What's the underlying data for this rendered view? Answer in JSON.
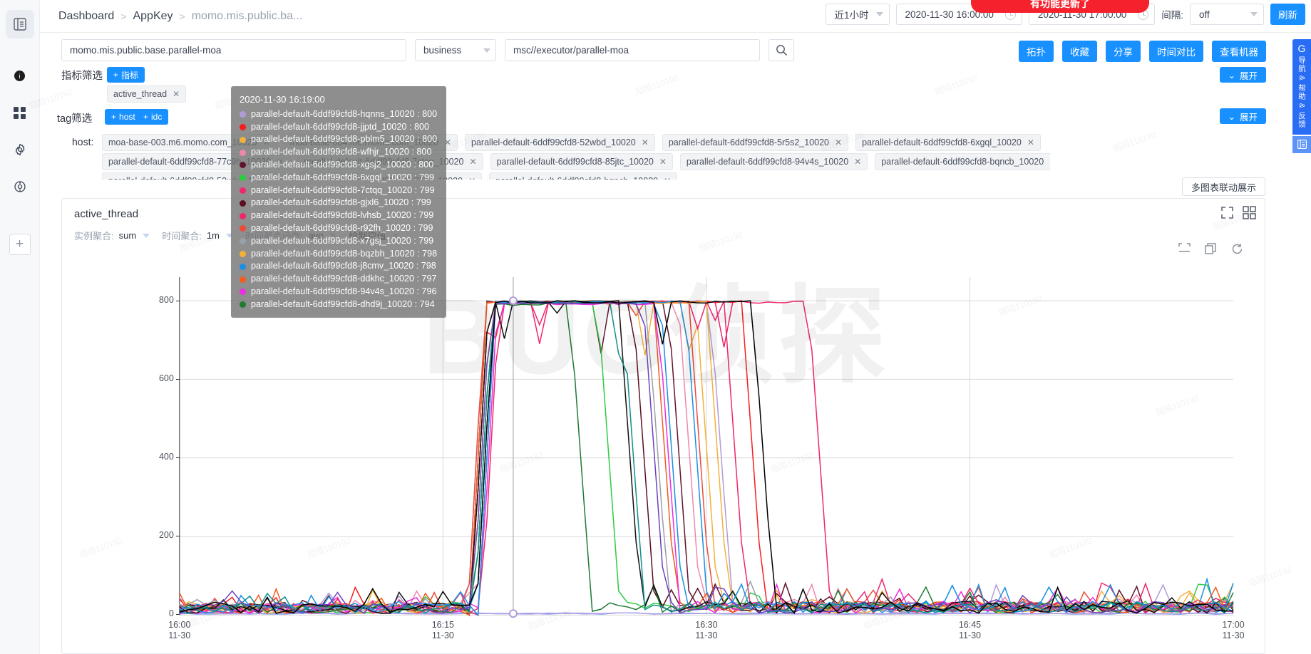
{
  "breadcrumb": {
    "items": [
      "Dashboard",
      "AppKey",
      "momo.mis.public.ba..."
    ],
    "sep": ">"
  },
  "topbar": {
    "range_preset": "近1小时",
    "start_time": "2020-11-30 16:00:00",
    "end_time": "2020-11-30 17:00:00",
    "interval_label": "间隔:",
    "interval_value": "off",
    "refresh_label": "刷新",
    "update_banner": "有功能更新了"
  },
  "query": {
    "appkey_value": "momo.mis.public.base.parallel-moa",
    "type_value": "business",
    "path_value": "msc//executor/parallel-moa",
    "search_icon": "search-icon"
  },
  "actions": [
    {
      "label": "拓扑",
      "name": "topology-button"
    },
    {
      "label": "收藏",
      "name": "favorite-button"
    },
    {
      "label": "分享",
      "name": "share-button"
    },
    {
      "label": "时间对比",
      "name": "time-compare-button"
    },
    {
      "label": "查看机器",
      "name": "view-machine-button"
    }
  ],
  "filters": {
    "metric_label": "指标筛选",
    "metric_add_button": "指标",
    "metric_chips": [
      "active_thread"
    ],
    "tag_label": "tag筛选",
    "tag_add_buttons": [
      "host",
      "idc"
    ],
    "host_label": "host:",
    "expand_label": "展开"
  },
  "host_chips": [
    [
      "moa-base-003.m6.momo.com_10020",
      "moa-base-004.m6.momo.com_10020",
      "parallel-default-6ddf99cfd8-52wbd_10020",
      "parallel-default-6ddf99cfd8-5r5s2_10020",
      "parallel-default-6ddf99cfd8-6xgql_10020"
    ],
    [
      "parallel-default-6ddf99cfd8-77c9h_10020",
      "parallel-default-6ddf99cfd8-7ctqq_10020",
      "parallel-default-6ddf99cfd8-85jtc_10020",
      "parallel-default-6ddf99cfd8-94v4s_10020",
      "parallel-default-6ddf99cfd8-bqncb_10020"
    ]
  ],
  "multi_chart_button": "多图表联动展示",
  "chart_panel": {
    "title": "active_thread",
    "agg": [
      {
        "label": "实例聚合:",
        "value": "sum"
      },
      {
        "label": "时间聚合:",
        "value": "1m"
      },
      {
        "label": "时间聚合函数:",
        "value": "avg"
      }
    ],
    "draw_null_label": "绘制空值",
    "tools": [
      "fullscreen-icon",
      "grid-icon"
    ],
    "tools2": [
      "zoom-out-icon",
      "copy-icon",
      "refresh-icon"
    ]
  },
  "tooltip": {
    "time": "2020-11-30 16:19:00",
    "rows": [
      {
        "name": "parallel-default-6ddf99cfd8-hqnns_10020",
        "value": 800,
        "color": "#b19cd9"
      },
      {
        "name": "parallel-default-6ddf99cfd8-jjptd_10020",
        "value": 800,
        "color": "#f81d1d"
      },
      {
        "name": "parallel-default-6ddf99cfd8-pblm5_10020",
        "value": 800,
        "color": "#f2b13b"
      },
      {
        "name": "parallel-default-6ddf99cfd8-wfhjr_10020",
        "value": 800,
        "color": "#ef87ae"
      },
      {
        "name": "parallel-default-6ddf99cfd8-xgsj2_10020",
        "value": 800,
        "color": "#62142e"
      },
      {
        "name": "parallel-default-6ddf99cfd8-6xgql_10020",
        "value": 799,
        "color": "#2ecc40"
      },
      {
        "name": "parallel-default-6ddf99cfd8-7ctqq_10020",
        "value": 799,
        "color": "#f0256f"
      },
      {
        "name": "parallel-default-6ddf99cfd8-gjxl6_10020",
        "value": 799,
        "color": "#5c0f22"
      },
      {
        "name": "parallel-default-6ddf99cfd8-lvhsb_10020",
        "value": 799,
        "color": "#f0256f"
      },
      {
        "name": "parallel-default-6ddf99cfd8-r92fh_10020",
        "value": 799,
        "color": "#ec4b3a"
      },
      {
        "name": "parallel-default-6ddf99cfd8-x7gsj_10020",
        "value": 799,
        "color": "#9aa0a8"
      },
      {
        "name": "parallel-default-6ddf99cfd8-bqzbh_10020",
        "value": 798,
        "color": "#f2b13b"
      },
      {
        "name": "parallel-default-6ddf99cfd8-j8cmv_10020",
        "value": 798,
        "color": "#1a8fe3"
      },
      {
        "name": "parallel-default-6ddf99cfd8-ddkhc_10020",
        "value": 797,
        "color": "#f25c1e"
      },
      {
        "name": "parallel-default-6ddf99cfd8-94v4s_10020",
        "value": 796,
        "color": "#ec2ee0"
      },
      {
        "name": "parallel-default-6ddf99cfd8-dhd9j_10020",
        "value": 794,
        "color": "#1f7a34"
      }
    ]
  },
  "feedback_rail": {
    "logo": "G",
    "text": "导航 & 帮助 & 反馈",
    "bottom_icon": "collapse-icon"
  },
  "sidebar": {
    "items": [
      {
        "name": "menu-collapse-icon",
        "glyph": "menu-collapse-icon"
      },
      {
        "name": "info-icon",
        "glyph": "info-icon"
      },
      {
        "name": "apps-icon",
        "glyph": "apps-icon"
      },
      {
        "name": "settings-icon",
        "glyph": "settings-icon"
      },
      {
        "name": "gear-icon",
        "glyph": "gear-icon"
      }
    ],
    "add_label": "+"
  },
  "watermark": {
    "text": "陌陌110192",
    "big": "BUG侦探"
  },
  "chart_data": {
    "type": "line",
    "title": "active_thread",
    "xlabel": "",
    "ylabel": "",
    "ylim": [
      0,
      860
    ],
    "yticks": [
      0,
      200,
      400,
      600,
      800
    ],
    "xticks": [
      {
        "top": "16:00",
        "bottom": "11-30"
      },
      {
        "top": "16:15",
        "bottom": "11-30"
      },
      {
        "top": "16:30",
        "bottom": "11-30"
      },
      {
        "top": "16:45",
        "bottom": "11-30"
      },
      {
        "top": "17:00",
        "bottom": "11-30"
      }
    ],
    "x_start": "2020-11-30 16:00",
    "x_end": "2020-11-30 17:00",
    "grid": true,
    "legend": "hidden",
    "cursor_time": "2020-11-30 16:19:00",
    "series": [
      {
        "name": "parallel-default-6ddf99cfd8-hqnns_10020",
        "color": "#b19cd9",
        "rise": 17.0,
        "fall": 31.0,
        "plateau": 800
      },
      {
        "name": "parallel-default-6ddf99cfd8-jjptd_10020",
        "color": "#f81d1d",
        "rise": 17.2,
        "fall": 32.8,
        "plateau": 800
      },
      {
        "name": "parallel-default-6ddf99cfd8-pblm5_10020",
        "color": "#f2b13b",
        "rise": 17.3,
        "fall": 30.2,
        "plateau": 800
      },
      {
        "name": "parallel-default-6ddf99cfd8-wfhjr_10020",
        "color": "#ef87ae",
        "rise": 17.5,
        "fall": 29.2,
        "plateau": 800
      },
      {
        "name": "parallel-default-6ddf99cfd8-xgsj2_10020",
        "color": "#62142e",
        "rise": 17.1,
        "fall": 28.6,
        "plateau": 800
      },
      {
        "name": "parallel-default-6ddf99cfd8-6xgql_10020",
        "color": "#2ecc40",
        "rise": 17.4,
        "fall": 24.6,
        "plateau": 799
      },
      {
        "name": "parallel-default-6ddf99cfd8-7ctqq_10020",
        "color": "#f0256f",
        "rise": 17.6,
        "fall": 36.6,
        "plateau": 799
      },
      {
        "name": "parallel-default-6ddf99cfd8-gjxl6_10020",
        "color": "#5c0f22",
        "rise": 17.2,
        "fall": 26.6,
        "plateau": 799
      },
      {
        "name": "parallel-default-6ddf99cfd8-lvhsb_10020",
        "color": "#f0256f",
        "rise": 17.8,
        "fall": 31.8,
        "plateau": 799
      },
      {
        "name": "parallel-default-6ddf99cfd8-r92fh_10020",
        "color": "#ec4b3a",
        "rise": 17.0,
        "fall": 29.8,
        "plateau": 799
      },
      {
        "name": "parallel-default-6ddf99cfd8-x7gsj_10020",
        "color": "#9aa0a8",
        "rise": 17.6,
        "fall": 27.4,
        "plateau": 799
      },
      {
        "name": "parallel-default-6ddf99cfd8-bqzbh_10020",
        "color": "#f2b13b",
        "rise": 17.3,
        "fall": 30.8,
        "plateau": 798
      },
      {
        "name": "parallel-default-6ddf99cfd8-j8cmv_10020",
        "color": "#1a8fe3",
        "rise": 17.5,
        "fall": 28.2,
        "plateau": 798
      },
      {
        "name": "parallel-default-6ddf99cfd8-ddkhc_10020",
        "color": "#f25c1e",
        "rise": 17.1,
        "fall": 27.8,
        "plateau": 797
      },
      {
        "name": "parallel-default-6ddf99cfd8-94v4s_10020",
        "color": "#ec2ee0",
        "rise": 17.7,
        "fall": 28.0,
        "plateau": 796
      },
      {
        "name": "parallel-default-6ddf99cfd8-dhd9j_10020",
        "color": "#1f7a34",
        "rise": 17.4,
        "fall": 23.0,
        "plateau": 794
      },
      {
        "name": "parallel-default-6ddf99cfd8-52wbd_10020",
        "color": "#111111",
        "rise": 17.2,
        "fall": 25.8,
        "plateau": 800
      },
      {
        "name": "parallel-default-6ddf99cfd8-5r5s2_10020",
        "color": "#1a8fe3",
        "rise": 17.6,
        "fall": 29.6,
        "plateau": 799
      },
      {
        "name": "parallel-default-6ddf99cfd8-85jtc_10020",
        "color": "#0e8f8f",
        "rise": 17.4,
        "fall": 26.0,
        "plateau": 798
      },
      {
        "name": "parallel-default-6ddf99cfd8-bqncb_10020",
        "color": "#6f42c1",
        "rise": 17.3,
        "fall": 27.2,
        "plateau": 797
      },
      {
        "name": "parallel-default-6ddf99cfd8-77c9h_10020",
        "color": "#000000",
        "rise": 17.5,
        "fall": 33.4,
        "plateau": 800
      }
    ],
    "baseline_series_note": "several flat near-zero series spanning the full range"
  }
}
